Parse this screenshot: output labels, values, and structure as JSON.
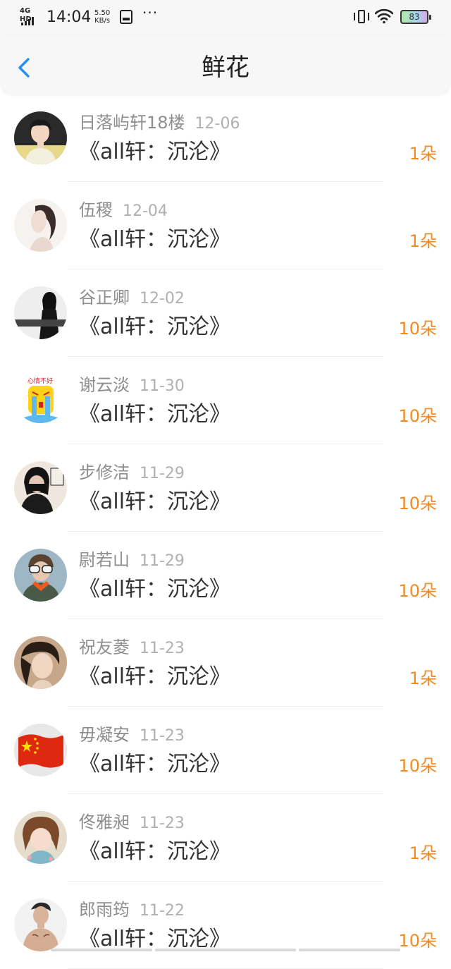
{
  "status_bar": {
    "network": "4G HD",
    "time": "14:04",
    "speed_value": "5.50",
    "speed_unit": "KB/s",
    "more": "···",
    "battery": "83"
  },
  "nav": {
    "back_icon": "chevron-left-icon",
    "title": "鲜花",
    "accent_color": "#2a8df5"
  },
  "colors": {
    "count": "#f08a24",
    "name": "#8e8e8e",
    "date": "#b0b0b0",
    "title": "#333333"
  },
  "items": [
    {
      "name": "日落屿轩18楼",
      "date": "12-06",
      "work": "《all轩：沉沦》",
      "count": "1朵",
      "avatar": "photo"
    },
    {
      "name": "伍稷",
      "date": "12-04",
      "work": "《all轩：沉沦》",
      "count": "1朵",
      "avatar": "drawing"
    },
    {
      "name": "谷正卿",
      "date": "12-02",
      "work": "《all轩：沉沦》",
      "count": "10朵",
      "avatar": "photo"
    },
    {
      "name": "谢云淡",
      "date": "11-30",
      "work": "《all轩：沉沦》",
      "count": "10朵",
      "avatar": "sticker",
      "avatar_text": "心情不好"
    },
    {
      "name": "步修洁",
      "date": "11-29",
      "work": "《all轩：沉沦》",
      "count": "10朵",
      "avatar": "photo"
    },
    {
      "name": "尉若山",
      "date": "11-29",
      "work": "《all轩：沉沦》",
      "count": "10朵",
      "avatar": "photo"
    },
    {
      "name": "祝友菱",
      "date": "11-23",
      "work": "《all轩：沉沦》",
      "count": "1朵",
      "avatar": "photo"
    },
    {
      "name": "毋凝安",
      "date": "11-23",
      "work": "《all轩：沉沦》",
      "count": "10朵",
      "avatar": "flag"
    },
    {
      "name": "佟雅昶",
      "date": "11-23",
      "work": "《all轩：沉沦》",
      "count": "1朵",
      "avatar": "photo"
    },
    {
      "name": "郎雨筠",
      "date": "11-22",
      "work": "《all轩：沉沦》",
      "count": "10朵",
      "avatar": "photo"
    }
  ]
}
